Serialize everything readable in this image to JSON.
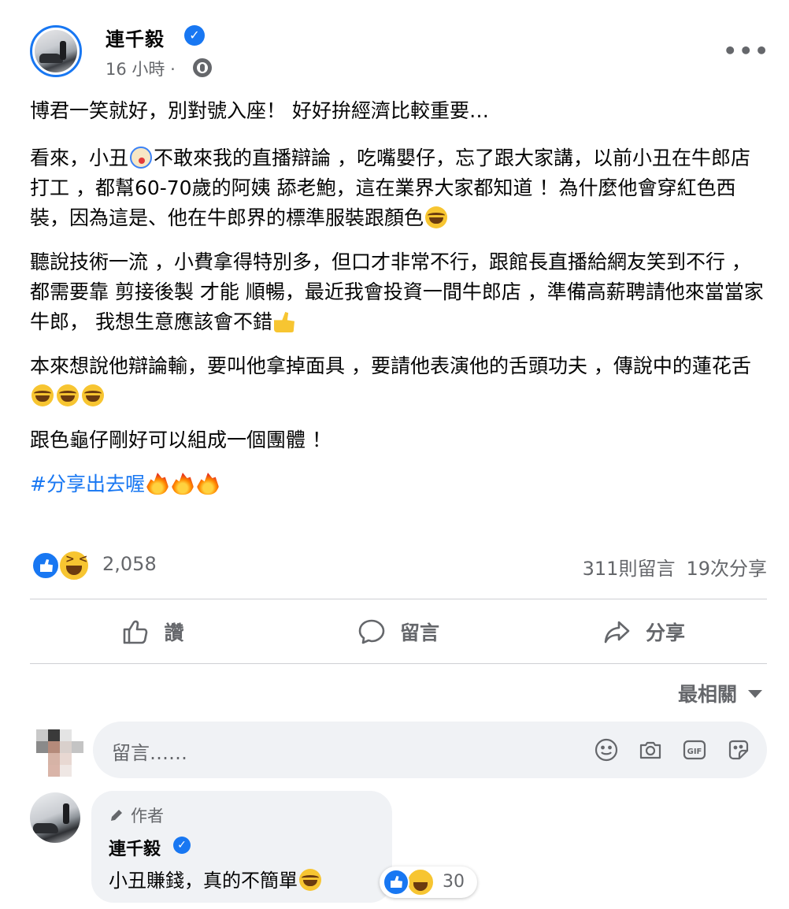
{
  "post": {
    "author": "連千毅",
    "time": "16 小時 ·",
    "more": "•••",
    "paragraphs": {
      "p1": "博君一笑就好，別對號入座！ 好好拚經濟比較重要…",
      "p2a": "看來，小丑",
      "p2b": "不敢來我的直播辯論 ，吃嘴嬰仔，忘了跟大家講，以前小丑在牛郎店打工 ，都幫60-70歲的阿姨 舔老鮑，這在業界大家都知道 ！為什麼他會穿紅色西裝，因為這是、他在牛郎界的標準服裝跟顏色",
      "p3a": "聽說技術一流 ，小費拿得特別多，但口才非常不行，跟館長直播給網友笑到不行 ，都需要靠 剪接後製 才能 順暢，最近我會投資一間牛郎店 ，準備高薪聘請他來當當家牛郎， 我想生意應該會不錯",
      "p4a": "本來想說他辯論輸，要叫他拿掉面具 ，要請他表演他的舌頭功夫 ，傳說中的蓮花舌",
      "p5": "跟色龜仔剛好可以組成一個團體 ！",
      "hashtag": "#分享出去喔"
    }
  },
  "stats": {
    "reaction_count": "2,058",
    "comments": "311則留言",
    "shares": "19次分享"
  },
  "actions": {
    "like": "讚",
    "comment": "留言",
    "share": "分享"
  },
  "sort_label": "最相關",
  "comment_input": {
    "placeholder": "留言……"
  },
  "top_comment": {
    "badge": "作者",
    "author": "連千毅",
    "text": "小丑賺錢，真的不簡單",
    "reaction_count": "30"
  },
  "colors": {
    "brand_blue": "#1877f2",
    "secondary_text": "#65676b",
    "bubble_bg": "#f0f2f5"
  }
}
